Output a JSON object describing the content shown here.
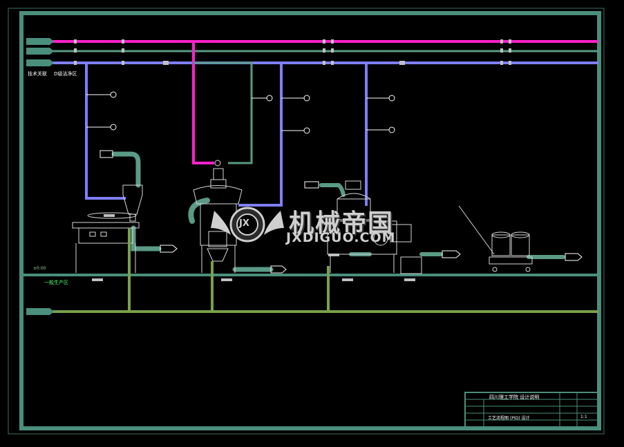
{
  "colors": {
    "frame": "#4a8f7c",
    "inner_line": "#3a7f6a",
    "magenta": "#ff22cc",
    "steam": "#5a9a86",
    "violet": "#7f7fff",
    "drain": "#7aa04c",
    "equipment": "#d8d8d8",
    "background": "#000000"
  },
  "header": {
    "area_label": "技术关联",
    "zone_label": "D级洁净区",
    "floor_level": "±0.00",
    "lower_label": "一般生产区"
  },
  "watermark": {
    "brand_cn": "机械帝国",
    "brand_url": "JXDIGUO.COM",
    "logo_letters": "JX"
  },
  "title_block": {
    "school": "四川理工学院 设计说明",
    "drawing_title": "工艺流程图 (PID) 设计",
    "scale": "1:1"
  }
}
